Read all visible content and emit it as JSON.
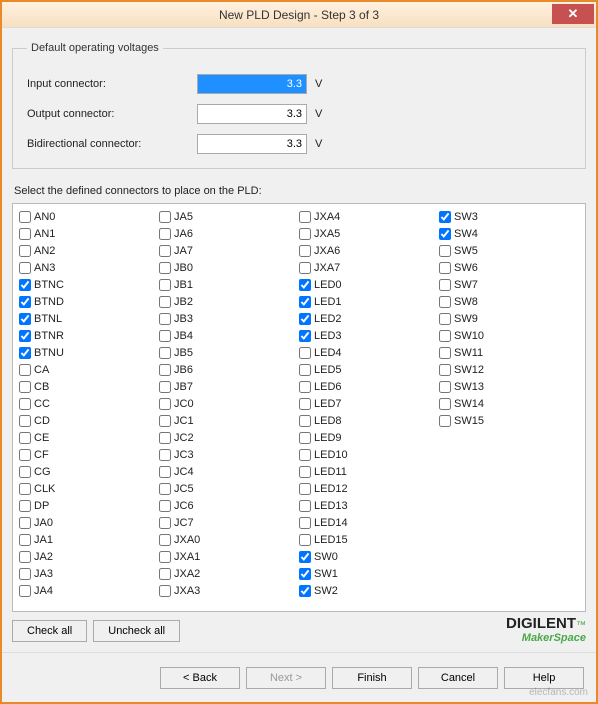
{
  "window": {
    "title": "New PLD Design - Step 3 of 3",
    "close_label": "✕"
  },
  "voltages": {
    "legend": "Default operating voltages",
    "rows": [
      {
        "label": "Input connector:",
        "value": "3.3",
        "unit": "V",
        "selected": true
      },
      {
        "label": "Output connector:",
        "value": "3.3",
        "unit": "V",
        "selected": false
      },
      {
        "label": "Bidirectional connector:",
        "value": "3.3",
        "unit": "V",
        "selected": false
      }
    ]
  },
  "connectors": {
    "prompt": "Select the defined connectors to place on the PLD:",
    "columns": [
      [
        {
          "name": "AN0",
          "checked": false
        },
        {
          "name": "AN1",
          "checked": false
        },
        {
          "name": "AN2",
          "checked": false
        },
        {
          "name": "AN3",
          "checked": false
        },
        {
          "name": "BTNC",
          "checked": true
        },
        {
          "name": "BTND",
          "checked": true
        },
        {
          "name": "BTNL",
          "checked": true
        },
        {
          "name": "BTNR",
          "checked": true
        },
        {
          "name": "BTNU",
          "checked": true
        },
        {
          "name": "CA",
          "checked": false
        },
        {
          "name": "CB",
          "checked": false
        },
        {
          "name": "CC",
          "checked": false
        },
        {
          "name": "CD",
          "checked": false
        },
        {
          "name": "CE",
          "checked": false
        },
        {
          "name": "CF",
          "checked": false
        },
        {
          "name": "CG",
          "checked": false
        },
        {
          "name": "CLK",
          "checked": false
        },
        {
          "name": "DP",
          "checked": false
        },
        {
          "name": "JA0",
          "checked": false
        },
        {
          "name": "JA1",
          "checked": false
        },
        {
          "name": "JA2",
          "checked": false
        },
        {
          "name": "JA3",
          "checked": false
        },
        {
          "name": "JA4",
          "checked": false
        }
      ],
      [
        {
          "name": "JA5",
          "checked": false
        },
        {
          "name": "JA6",
          "checked": false
        },
        {
          "name": "JA7",
          "checked": false
        },
        {
          "name": "JB0",
          "checked": false
        },
        {
          "name": "JB1",
          "checked": false
        },
        {
          "name": "JB2",
          "checked": false
        },
        {
          "name": "JB3",
          "checked": false
        },
        {
          "name": "JB4",
          "checked": false
        },
        {
          "name": "JB5",
          "checked": false
        },
        {
          "name": "JB6",
          "checked": false
        },
        {
          "name": "JB7",
          "checked": false
        },
        {
          "name": "JC0",
          "checked": false
        },
        {
          "name": "JC1",
          "checked": false
        },
        {
          "name": "JC2",
          "checked": false
        },
        {
          "name": "JC3",
          "checked": false
        },
        {
          "name": "JC4",
          "checked": false
        },
        {
          "name": "JC5",
          "checked": false
        },
        {
          "name": "JC6",
          "checked": false
        },
        {
          "name": "JC7",
          "checked": false
        },
        {
          "name": "JXA0",
          "checked": false
        },
        {
          "name": "JXA1",
          "checked": false
        },
        {
          "name": "JXA2",
          "checked": false
        },
        {
          "name": "JXA3",
          "checked": false
        }
      ],
      [
        {
          "name": "JXA4",
          "checked": false
        },
        {
          "name": "JXA5",
          "checked": false
        },
        {
          "name": "JXA6",
          "checked": false
        },
        {
          "name": "JXA7",
          "checked": false
        },
        {
          "name": "LED0",
          "checked": true
        },
        {
          "name": "LED1",
          "checked": true
        },
        {
          "name": "LED2",
          "checked": true
        },
        {
          "name": "LED3",
          "checked": true
        },
        {
          "name": "LED4",
          "checked": false
        },
        {
          "name": "LED5",
          "checked": false
        },
        {
          "name": "LED6",
          "checked": false
        },
        {
          "name": "LED7",
          "checked": false
        },
        {
          "name": "LED8",
          "checked": false
        },
        {
          "name": "LED9",
          "checked": false
        },
        {
          "name": "LED10",
          "checked": false
        },
        {
          "name": "LED11",
          "checked": false
        },
        {
          "name": "LED12",
          "checked": false
        },
        {
          "name": "LED13",
          "checked": false
        },
        {
          "name": "LED14",
          "checked": false
        },
        {
          "name": "LED15",
          "checked": false
        },
        {
          "name": "SW0",
          "checked": true
        },
        {
          "name": "SW1",
          "checked": true
        },
        {
          "name": "SW2",
          "checked": true
        }
      ],
      [
        {
          "name": "SW3",
          "checked": true
        },
        {
          "name": "SW4",
          "checked": true
        },
        {
          "name": "SW5",
          "checked": false
        },
        {
          "name": "SW6",
          "checked": false
        },
        {
          "name": "SW7",
          "checked": false
        },
        {
          "name": "SW8",
          "checked": false
        },
        {
          "name": "SW9",
          "checked": false
        },
        {
          "name": "SW10",
          "checked": false
        },
        {
          "name": "SW11",
          "checked": false
        },
        {
          "name": "SW12",
          "checked": false
        },
        {
          "name": "SW13",
          "checked": false
        },
        {
          "name": "SW14",
          "checked": false
        },
        {
          "name": "SW15",
          "checked": false
        }
      ]
    ],
    "check_all": "Check all",
    "uncheck_all": "Uncheck all"
  },
  "footer": {
    "back": "< Back",
    "next": "Next >",
    "finish": "Finish",
    "cancel": "Cancel",
    "help": "Help"
  },
  "branding": {
    "brand1": "DIGILENT",
    "tm": "™",
    "maker": "MakerSpace",
    "watermark": "elecfans.com"
  }
}
